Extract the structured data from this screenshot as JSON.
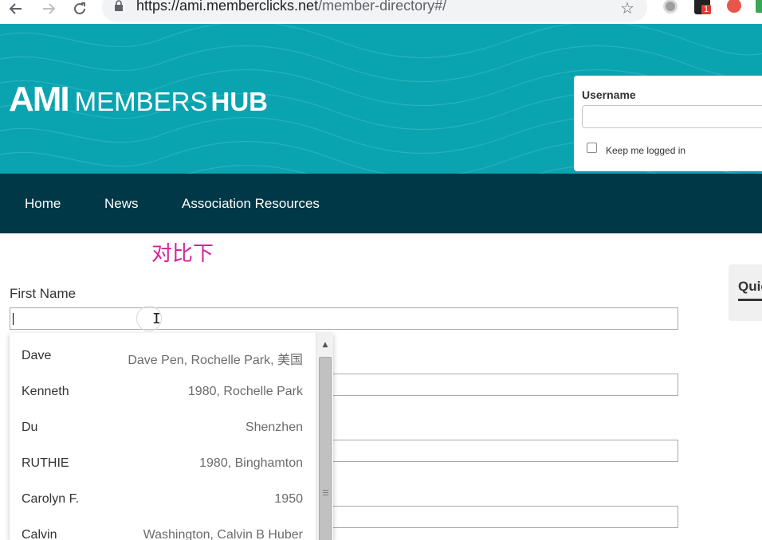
{
  "browser": {
    "url_host": "https://ami.memberclicks.net",
    "url_path": "/member-directory#/",
    "extension_badge": "1"
  },
  "header": {
    "logo_ami": "AMI",
    "logo_members": "MEMBERS",
    "logo_hub": "HUB",
    "login": {
      "username_label": "Username",
      "keep_logged_in": "Keep me logged in"
    }
  },
  "nav": {
    "items": [
      {
        "label": "Home"
      },
      {
        "label": "News"
      },
      {
        "label": "Association Resources"
      }
    ]
  },
  "main": {
    "annotation": "对比下",
    "first_name_label": "First Name",
    "first_name_value": ""
  },
  "sidebar": {
    "quick_title": "Quic"
  },
  "autocomplete": {
    "items": [
      {
        "name": "Dave",
        "detail": "Dave Pen, Rochelle Park, 美国"
      },
      {
        "name": "Kenneth",
        "detail": "1980, Rochelle Park"
      },
      {
        "name": "Du",
        "detail": "Shenzhen"
      },
      {
        "name": "RUTHIE",
        "detail": "1980, Binghamton"
      },
      {
        "name": "Carolyn F.",
        "detail": "1950"
      },
      {
        "name": "Calvin",
        "detail": "Washington, Calvin B Huber"
      }
    ]
  },
  "colors": {
    "banner": "#0aa4b0",
    "navbar": "#003847",
    "annotation": "#d6239a"
  }
}
